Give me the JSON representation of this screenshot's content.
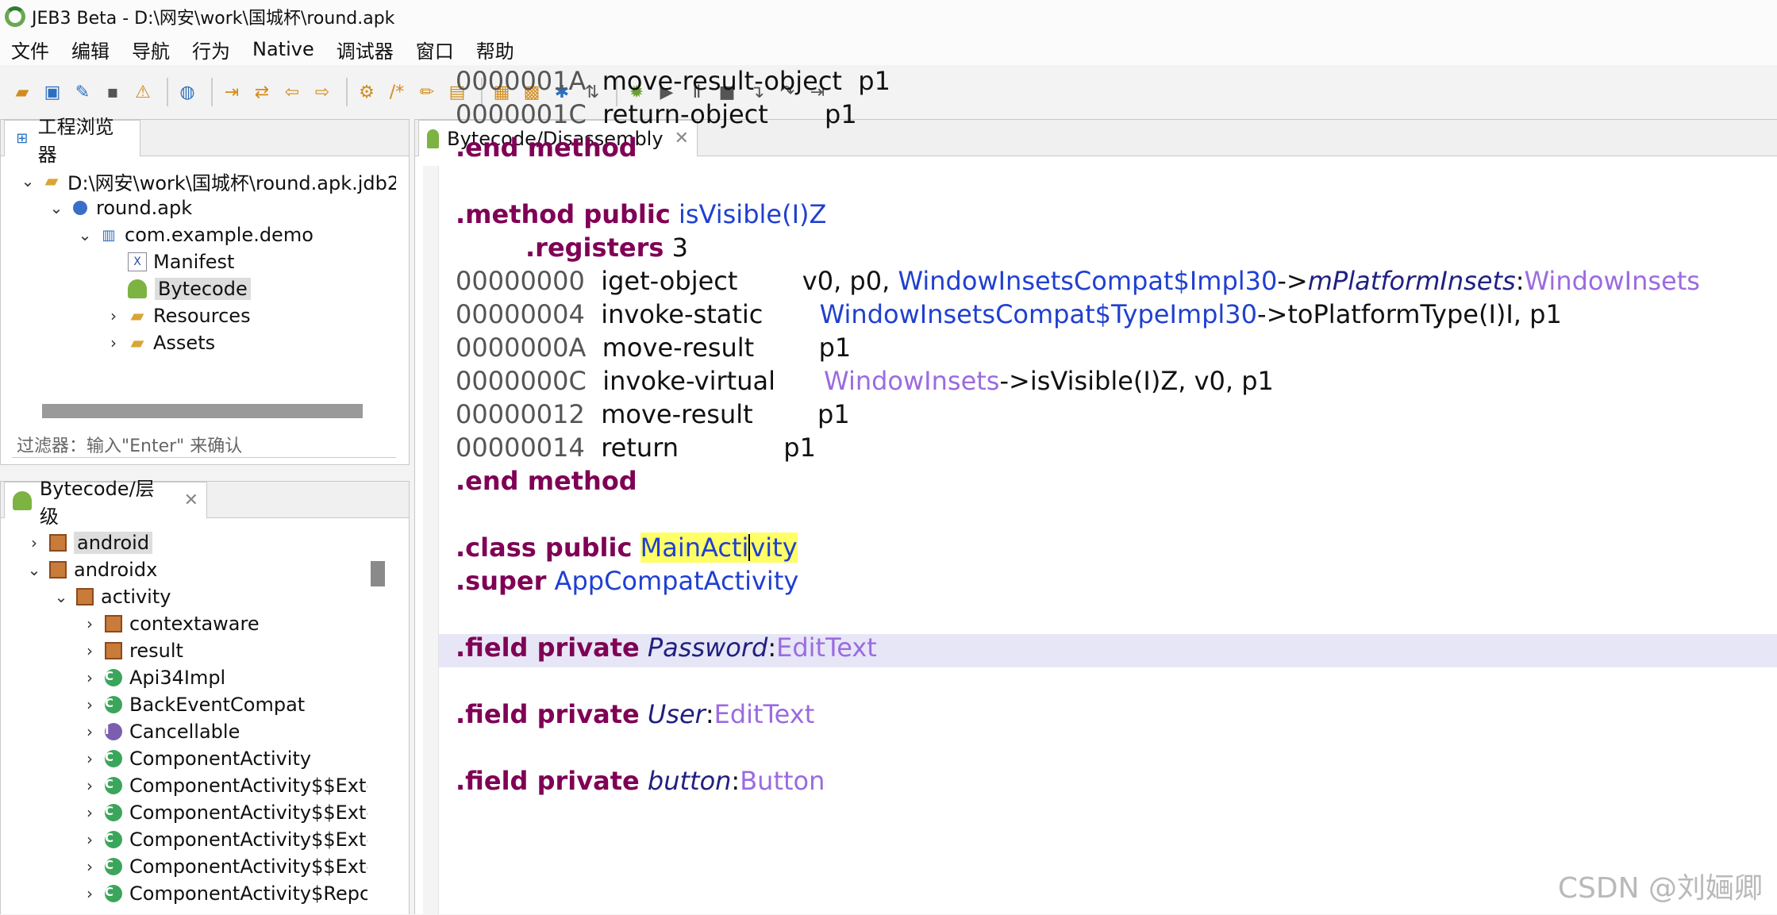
{
  "window": {
    "title": "JEB3 Beta - D:\\网安\\work\\国城杯\\round.apk"
  },
  "menu": [
    "文件",
    "编辑",
    "导航",
    "行为",
    "Native",
    "调试器",
    "窗口",
    "帮助"
  ],
  "project_panel": {
    "tab": "工程浏览器",
    "tree": [
      {
        "label": "D:\\网安\\work\\国城杯\\round.apk.jdb2"
      },
      {
        "label": "round.apk"
      },
      {
        "label": "com.example.demo"
      },
      {
        "label": "Manifest"
      },
      {
        "label": "Bytecode"
      },
      {
        "label": "Resources"
      },
      {
        "label": "Assets"
      }
    ],
    "filter_placeholder": "过滤器：输入\"Enter\" 来确认"
  },
  "hierarchy_panel": {
    "tab": "Bytecode/层级",
    "tree": [
      {
        "label": "android"
      },
      {
        "label": "androidx"
      },
      {
        "label": "activity"
      },
      {
        "label": "contextaware"
      },
      {
        "label": "result"
      },
      {
        "label": "Api34Impl"
      },
      {
        "label": "BackEventCompat"
      },
      {
        "label": "Cancellable"
      },
      {
        "label": "ComponentActivity"
      },
      {
        "label": "ComponentActivity$$Exte"
      },
      {
        "label": "ComponentActivity$$Exte"
      },
      {
        "label": "ComponentActivity$$Exte"
      },
      {
        "label": "ComponentActivity$$Exte"
      },
      {
        "label": "ComponentActivity$Repc"
      }
    ]
  },
  "editor": {
    "tab": "Bytecode/Disassembly",
    "lines": {
      "l1": {
        "addr": "0000001A",
        "op": "move-result-object",
        "args": "p1"
      },
      "l2": {
        "addr": "0000001C",
        "op": "return-object",
        "args": "p1"
      },
      "l3": {
        "kw": ".end method"
      },
      "l4": {
        "kw": ".method public",
        "name": "isVisible(I)Z"
      },
      "l5": {
        "kw": ".registers",
        "val": "3"
      },
      "l6": {
        "addr": "00000000",
        "op": "iget-object",
        "a1": "v0, p0,",
        "ref": "WindowInsetsCompat$Impl30",
        "arrow": "->",
        "field": "mPlatformInsets",
        "colon": ":",
        "type": "WindowInsets"
      },
      "l7": {
        "addr": "00000004",
        "op": "invoke-static",
        "ref": "WindowInsetsCompat$TypeImpl30",
        "rest": "->toPlatformType(I)I, p1"
      },
      "l8": {
        "addr": "0000000A",
        "op": "move-result",
        "args": "p1"
      },
      "l9": {
        "addr": "0000000C",
        "op": "invoke-virtual",
        "ref": "WindowInsets",
        "rest": "->isVisible(I)Z, v0, p1"
      },
      "l10": {
        "addr": "00000012",
        "op": "move-result",
        "args": "p1"
      },
      "l11": {
        "addr": "00000014",
        "op": "return",
        "args": "p1"
      },
      "l12": {
        "kw": ".end method"
      },
      "l13": {
        "kw": ".class public",
        "hl_a": "MainActi",
        "hl_b": "vity"
      },
      "l14": {
        "kw": ".super",
        "ref": "AppCompatActivity"
      },
      "l15": {
        "kw": ".field private",
        "field": "Password",
        "colon": ":",
        "type": "EditText"
      },
      "l16": {
        "kw": ".field private",
        "field": "User",
        "colon": ":",
        "type": "EditText"
      },
      "l17": {
        "kw": ".field private",
        "field": "button",
        "colon": ":",
        "type": "Button"
      }
    }
  },
  "watermark": "CSDN @刘婳卿"
}
